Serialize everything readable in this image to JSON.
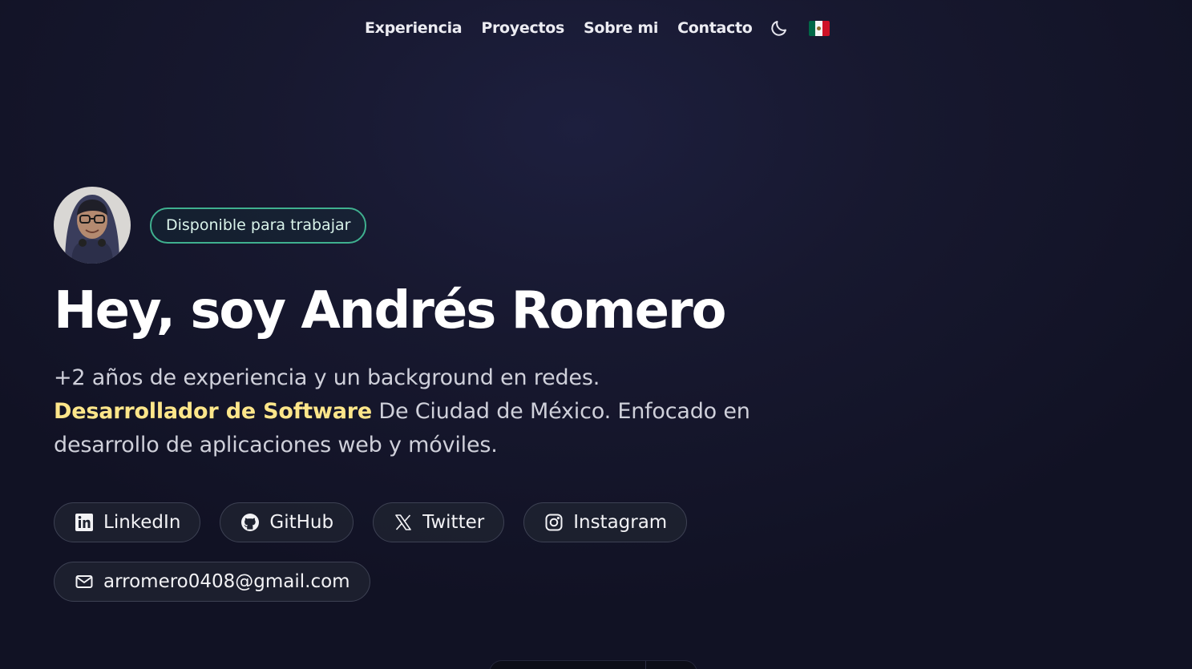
{
  "nav": {
    "items": [
      {
        "label": "Experiencia"
      },
      {
        "label": "Proyectos"
      },
      {
        "label": "Sobre mi"
      },
      {
        "label": "Contacto"
      }
    ],
    "theme_icon": "moon-icon",
    "language_icon": "mexico-flag-icon"
  },
  "hero": {
    "status_badge": "Disponible para trabajar",
    "title": "Hey, soy Andrés Romero",
    "description": {
      "line1": "+2 años de experiencia y un background en redes.",
      "highlight": "Desarrollador de Software",
      "rest": " De Ciudad de México. Enfocado en desarrollo de aplicaciones web y móviles."
    },
    "social_links": [
      {
        "label": "LinkedIn",
        "icon": "linkedin-icon"
      },
      {
        "label": "GitHub",
        "icon": "github-icon"
      },
      {
        "label": "Twitter",
        "icon": "x-twitter-icon"
      },
      {
        "label": "Instagram",
        "icon": "instagram-icon"
      }
    ],
    "email": "arromero0408@gmail.com"
  },
  "colors": {
    "background": "#17182f",
    "highlight": "#fde68a",
    "badge_border": "#3fb08f",
    "text": "#cfd0da"
  }
}
